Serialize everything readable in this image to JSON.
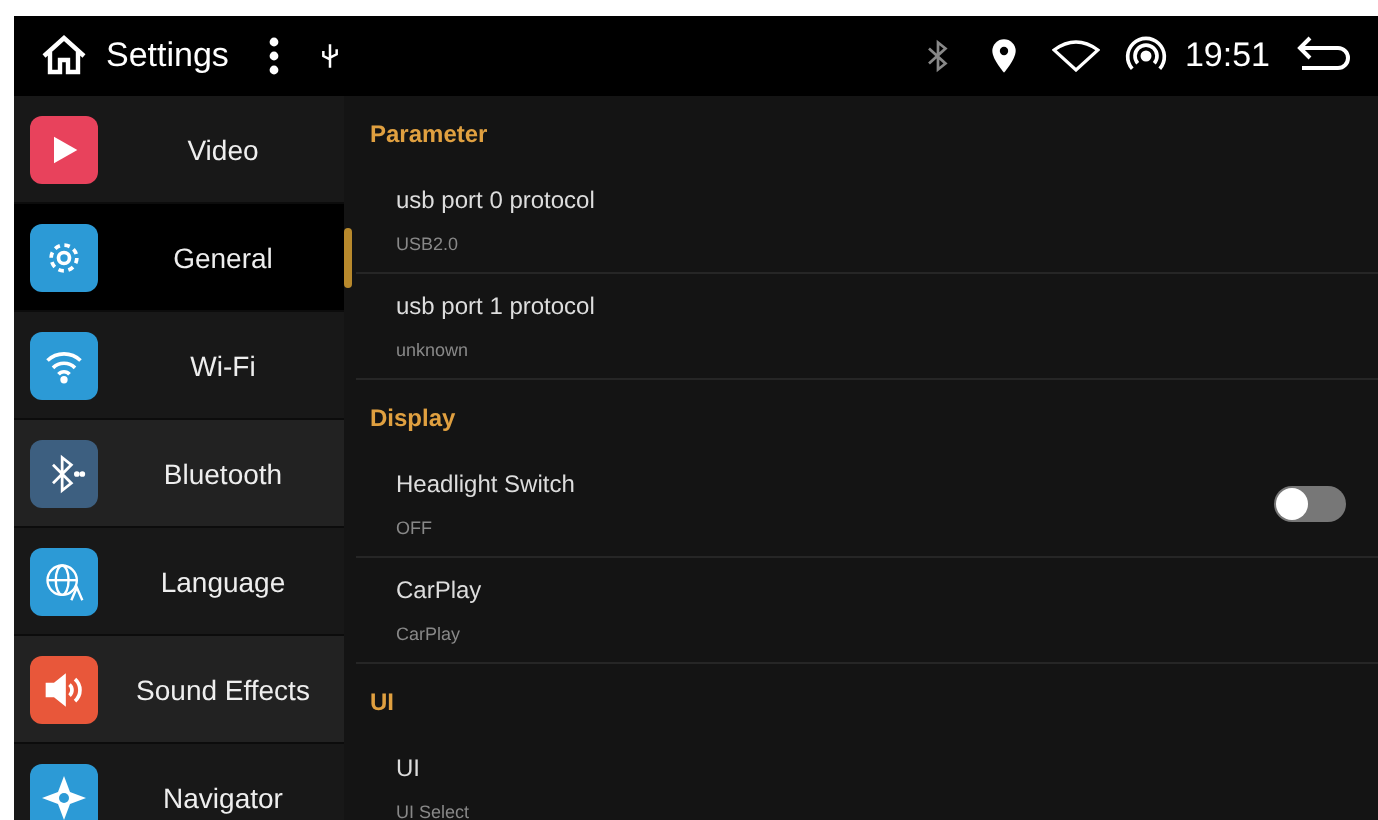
{
  "status_bar": {
    "title": "Settings",
    "time": "19:51"
  },
  "sidebar": {
    "items": [
      {
        "label": "Video",
        "selected": false,
        "color": "#e8425c"
      },
      {
        "label": "General",
        "selected": true,
        "color": "#2c9ad6"
      },
      {
        "label": "Wi-Fi",
        "selected": false,
        "color": "#2c9ad6"
      },
      {
        "label": "Bluetooth",
        "selected": false,
        "color": "#3d5f80"
      },
      {
        "label": "Language",
        "selected": false,
        "color": "#2c9ad6"
      },
      {
        "label": "Sound Effects",
        "selected": false,
        "color": "#e8573a"
      },
      {
        "label": "Navigator",
        "selected": false,
        "color": "#2c9ad6"
      }
    ]
  },
  "sections": [
    {
      "title": "Parameter",
      "items": [
        {
          "kind": "info",
          "title": "usb port 0 protocol",
          "summary": "USB2.0"
        },
        {
          "kind": "info",
          "title": "usb port 1 protocol",
          "summary": "unknown"
        }
      ]
    },
    {
      "title": "Display",
      "items": [
        {
          "kind": "toggle",
          "title": "Headlight Switch",
          "summary": "OFF",
          "on": false
        },
        {
          "kind": "info",
          "title": "CarPlay",
          "summary": "CarPlay"
        }
      ]
    },
    {
      "title": "UI",
      "items": [
        {
          "kind": "info",
          "title": "UI",
          "summary": "UI Select"
        }
      ]
    }
  ]
}
